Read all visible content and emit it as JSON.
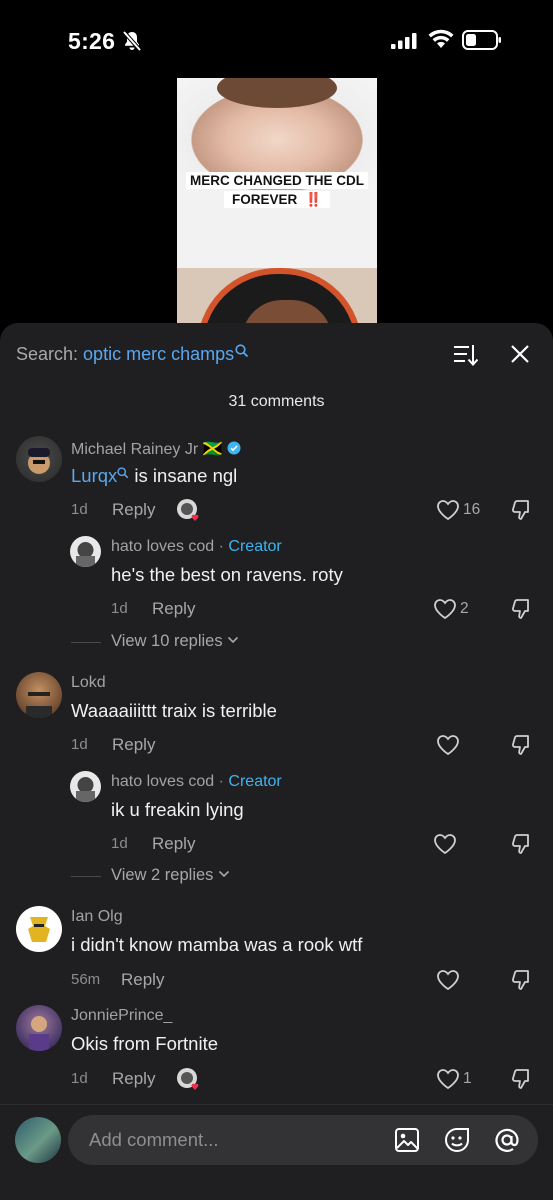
{
  "status": {
    "time": "5:26"
  },
  "video": {
    "caption_line1": "MERC CHANGED THE CDL",
    "caption_line2": "FOREVER",
    "caption_emoji": "‼️"
  },
  "sheet": {
    "search_prefix": "Search: ",
    "search_query": "optic merc champs",
    "count_label": "31 comments"
  },
  "comments": [
    {
      "username": "Michael Rainey Jr",
      "flag": "🇯🇲",
      "verified": true,
      "mention": "Lurqx",
      "text": " is insane ngl",
      "time": "1d",
      "reply": "Reply",
      "likes": "16",
      "creator_liked": true
    },
    {
      "username": "hato loves cod",
      "role": "Creator",
      "sep": " · ",
      "text": "he's the best on ravens. roty",
      "time": "1d",
      "reply": "Reply",
      "likes": "2",
      "view_replies": "View 10 replies"
    },
    {
      "username": "Lokd",
      "text": "Waaaaiiittt traix is terrible",
      "time": "1d",
      "reply": "Reply",
      "likes": ""
    },
    {
      "username": "hato loves cod",
      "role": "Creator",
      "sep": " · ",
      "text": "ik u freakin lying",
      "time": "1d",
      "reply": "Reply",
      "likes": "",
      "view_replies": "View 2 replies"
    },
    {
      "username": "Ian Olg",
      "text": "i didn't know mamba was a rook wtf",
      "time": "56m",
      "reply": "Reply",
      "likes": ""
    },
    {
      "username": "JonniePrince_",
      "text": "Okis from Fortnite",
      "time": "1d",
      "reply": "Reply",
      "likes": "1",
      "creator_liked": true
    }
  ],
  "composer": {
    "placeholder": "Add comment..."
  },
  "icons": [
    "bell-slash-icon",
    "cellular-signal-icon",
    "wifi-icon",
    "battery-icon",
    "search-icon",
    "sort-icon",
    "close-icon",
    "verified-icon",
    "heart-icon",
    "dislike-icon",
    "image-icon",
    "emoji-icon",
    "at-icon",
    "chevron-down-icon"
  ],
  "colors": {
    "accent": "#5aa8f0",
    "creator": "#3fb4f0",
    "sheet_bg": "#1f1f21",
    "input_bg": "#333336"
  }
}
